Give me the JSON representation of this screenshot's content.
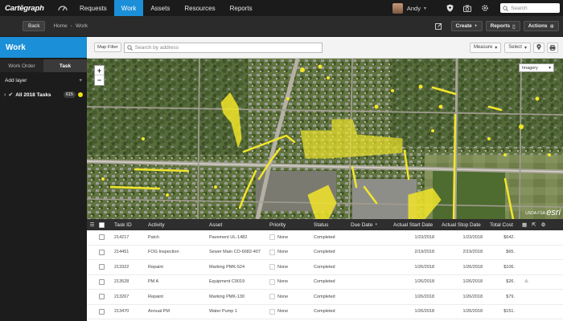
{
  "app": {
    "logo": "Cartēgraph"
  },
  "topnav": {
    "items": [
      {
        "label": "Requests"
      },
      {
        "label": "Work"
      },
      {
        "label": "Assets"
      },
      {
        "label": "Resources"
      },
      {
        "label": "Reports"
      }
    ],
    "active_index": 1,
    "user": "Andy",
    "search_placeholder": "Search",
    "accent": "#1b8fd8"
  },
  "subbar": {
    "back_label": "Back",
    "breadcrumb": [
      "Home",
      "Work"
    ],
    "create_label": "Create",
    "reports_label": "Reports",
    "actions_label": "Actions"
  },
  "sidebar": {
    "title": "Work",
    "tabs": [
      {
        "label": "Work Order"
      },
      {
        "label": "Task"
      }
    ],
    "active_tab": 1,
    "add_layer_label": "Add layer",
    "add_layer_icon": "+",
    "layers": [
      {
        "label": "All 2018 Tasks",
        "count": "615",
        "color": "#f4e20f"
      }
    ]
  },
  "map_toolbar": {
    "filter_label": "Map Filter",
    "search_placeholder": "Search by address",
    "measure_label": "Measure",
    "select_label": "Select"
  },
  "map": {
    "zoom_in": "+",
    "zoom_out": "−",
    "basemap": "Imagery",
    "attribution": "USDA FSA",
    "esri": "esri",
    "highlight_color": "#f2e62a"
  },
  "table": {
    "columns": [
      "Task ID",
      "Activity",
      "Asset",
      "Priority",
      "Status",
      "Due Date",
      "Actual Start Date",
      "Actual Stop Date",
      "Total Cost"
    ],
    "rows": [
      {
        "task_id": "214217",
        "activity": "Patch",
        "asset": "Pavement UL-1482",
        "priority": "None",
        "status": "Completed",
        "due": "",
        "start": "1/23/2018",
        "stop": "1/23/2018",
        "cost": "$642."
      },
      {
        "task_id": "214451",
        "activity": "FOG Inspection",
        "asset": "Sewer Main CO-6682-407",
        "priority": "None",
        "status": "Completed",
        "due": "",
        "start": "2/19/2018",
        "stop": "2/19/2018",
        "cost": "$65."
      },
      {
        "task_id": "213322",
        "activity": "Repaint",
        "asset": "Marking PMK-524",
        "priority": "None",
        "status": "Completed",
        "due": "",
        "start": "1/26/2018",
        "stop": "1/26/2018",
        "cost": "$106."
      },
      {
        "task_id": "213528",
        "activity": "PM A",
        "asset": "Equipment C9019",
        "priority": "None",
        "status": "Completed",
        "due": "",
        "start": "1/26/2018",
        "stop": "1/26/2018",
        "cost": "$26."
      },
      {
        "task_id": "213267",
        "activity": "Repaint",
        "asset": "Marking PMK-130",
        "priority": "None",
        "status": "Completed",
        "due": "",
        "start": "1/26/2018",
        "stop": "1/26/2018",
        "cost": "$79."
      },
      {
        "task_id": "213470",
        "activity": "Annual PM",
        "asset": "Water Pump 1",
        "priority": "None",
        "status": "Completed",
        "due": "",
        "start": "1/26/2018",
        "stop": "1/26/2018",
        "cost": "$151."
      }
    ]
  }
}
